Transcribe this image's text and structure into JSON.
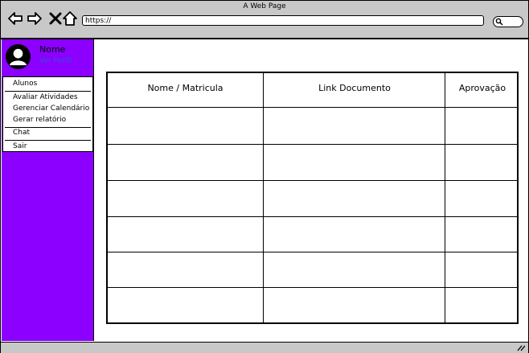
{
  "window": {
    "title": "A Web Page"
  },
  "address_bar": {
    "url": "https://"
  },
  "user": {
    "name": "Nome",
    "link": "Ver Perfil"
  },
  "menu": {
    "items": [
      {
        "label": "Alunos"
      },
      {
        "label": "Avaliar Atividades"
      },
      {
        "label": "Gerenciar Calendário"
      },
      {
        "label": "Gerar relatório"
      },
      {
        "label": "Chat"
      },
      {
        "label": "Sair"
      }
    ]
  },
  "table": {
    "headers": [
      "Nome / Matricula",
      "Link Documento",
      "Aprovação"
    ],
    "rows": [
      [
        "",
        "",
        ""
      ],
      [
        "",
        "",
        ""
      ],
      [
        "",
        "",
        ""
      ],
      [
        "",
        "",
        ""
      ],
      [
        "",
        "",
        ""
      ],
      [
        "",
        "",
        ""
      ]
    ]
  },
  "colors": {
    "sidebar": "#8b00ff",
    "chrome": "#c8c8c8",
    "link": "#3b4bd6"
  },
  "icons": [
    "back-arrow-icon",
    "forward-arrow-icon",
    "close-icon",
    "home-icon",
    "search-icon",
    "user-avatar-icon",
    "resize-grip-icon"
  ]
}
